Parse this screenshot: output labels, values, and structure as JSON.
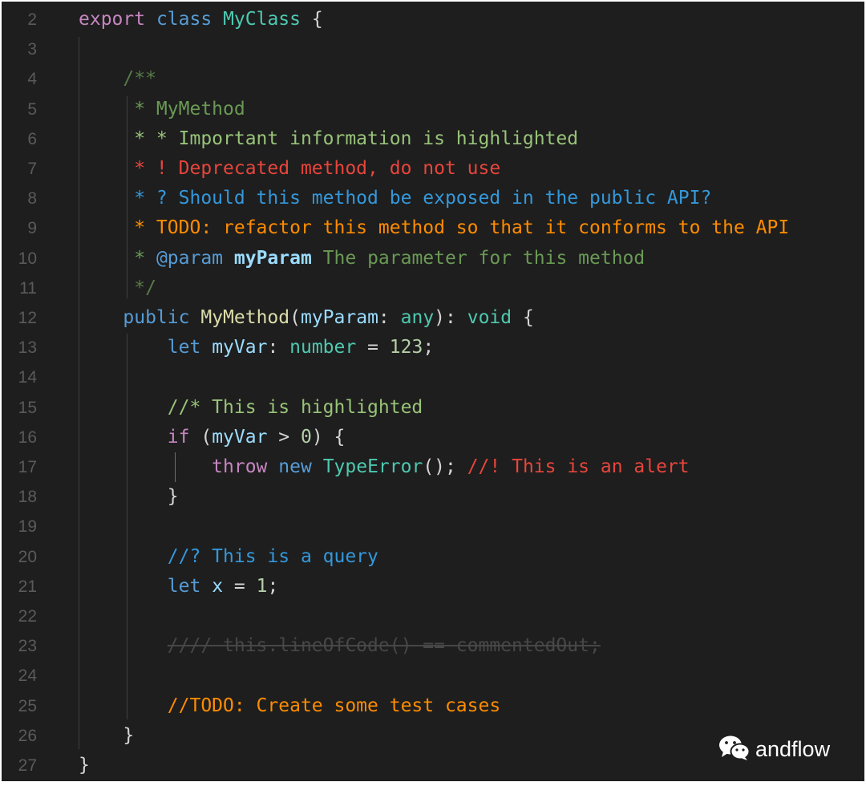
{
  "editor": {
    "lines": [
      {
        "num": "2",
        "tokens": [
          {
            "t": "export",
            "c": "kw2"
          },
          {
            "t": " ",
            "c": "punc"
          },
          {
            "t": "class",
            "c": "kw"
          },
          {
            "t": " ",
            "c": "punc"
          },
          {
            "t": "MyClass",
            "c": "cls"
          },
          {
            "t": " {",
            "c": "punc"
          }
        ]
      },
      {
        "num": "3",
        "tokens": []
      },
      {
        "num": "4",
        "tokens": [
          {
            "t": "    /**",
            "c": "cmt-dim"
          }
        ]
      },
      {
        "num": "5",
        "tokens": [
          {
            "t": "     * MyMethod",
            "c": "cmt"
          }
        ]
      },
      {
        "num": "6",
        "tokens": [
          {
            "t": "     * * Important information is highlighted",
            "c": "hl-green"
          }
        ]
      },
      {
        "num": "7",
        "tokens": [
          {
            "t": "     * ! Deprecated method, do not use",
            "c": "hl-red"
          }
        ]
      },
      {
        "num": "8",
        "tokens": [
          {
            "t": "     * ? Should this method be exposed in the public API?",
            "c": "hl-blue"
          }
        ]
      },
      {
        "num": "9",
        "tokens": [
          {
            "t": "     * TODO: refactor this method so that it conforms to the API",
            "c": "hl-orange"
          }
        ]
      },
      {
        "num": "10",
        "tokens": [
          {
            "t": "     * ",
            "c": "cmt"
          },
          {
            "t": "@param",
            "c": "kw"
          },
          {
            "t": " ",
            "c": "cmt"
          },
          {
            "t": "myParam",
            "c": "var bold"
          },
          {
            "t": " The parameter for this method",
            "c": "cmt"
          }
        ]
      },
      {
        "num": "11",
        "tokens": [
          {
            "t": "     */",
            "c": "cmt-dim"
          }
        ]
      },
      {
        "num": "12",
        "tokens": [
          {
            "t": "    ",
            "c": "punc"
          },
          {
            "t": "public",
            "c": "kw"
          },
          {
            "t": " ",
            "c": "punc"
          },
          {
            "t": "MyMethod",
            "c": "fn"
          },
          {
            "t": "(",
            "c": "punc"
          },
          {
            "t": "myParam",
            "c": "var"
          },
          {
            "t": ": ",
            "c": "punc"
          },
          {
            "t": "any",
            "c": "cls"
          },
          {
            "t": "): ",
            "c": "punc"
          },
          {
            "t": "void",
            "c": "cls"
          },
          {
            "t": " {",
            "c": "punc"
          }
        ]
      },
      {
        "num": "13",
        "tokens": [
          {
            "t": "        ",
            "c": "punc"
          },
          {
            "t": "let",
            "c": "kw"
          },
          {
            "t": " ",
            "c": "punc"
          },
          {
            "t": "myVar",
            "c": "var"
          },
          {
            "t": ": ",
            "c": "punc"
          },
          {
            "t": "number",
            "c": "cls"
          },
          {
            "t": " = ",
            "c": "punc"
          },
          {
            "t": "123",
            "c": "num"
          },
          {
            "t": ";",
            "c": "punc"
          }
        ]
      },
      {
        "num": "14",
        "tokens": []
      },
      {
        "num": "15",
        "tokens": [
          {
            "t": "        //* This is highlighted",
            "c": "hl-green"
          }
        ]
      },
      {
        "num": "16",
        "tokens": [
          {
            "t": "        ",
            "c": "punc"
          },
          {
            "t": "if",
            "c": "kw2"
          },
          {
            "t": " (",
            "c": "punc"
          },
          {
            "t": "myVar",
            "c": "var"
          },
          {
            "t": " > ",
            "c": "punc"
          },
          {
            "t": "0",
            "c": "num"
          },
          {
            "t": ") {",
            "c": "punc"
          }
        ]
      },
      {
        "num": "17",
        "tokens": [
          {
            "t": "            ",
            "c": "punc"
          },
          {
            "t": "throw",
            "c": "kw2"
          },
          {
            "t": " ",
            "c": "punc"
          },
          {
            "t": "new",
            "c": "kw"
          },
          {
            "t": " ",
            "c": "punc"
          },
          {
            "t": "TypeError",
            "c": "cls"
          },
          {
            "t": "(); ",
            "c": "punc"
          },
          {
            "t": "//! This is an alert",
            "c": "hl-red"
          }
        ]
      },
      {
        "num": "18",
        "tokens": [
          {
            "t": "        }",
            "c": "punc"
          }
        ]
      },
      {
        "num": "19",
        "tokens": []
      },
      {
        "num": "20",
        "tokens": [
          {
            "t": "        //? This is a query",
            "c": "hl-blue"
          }
        ]
      },
      {
        "num": "21",
        "tokens": [
          {
            "t": "        ",
            "c": "punc"
          },
          {
            "t": "let",
            "c": "kw"
          },
          {
            "t": " ",
            "c": "punc"
          },
          {
            "t": "x",
            "c": "var"
          },
          {
            "t": " = ",
            "c": "punc"
          },
          {
            "t": "1",
            "c": "num"
          },
          {
            "t": ";",
            "c": "punc"
          }
        ]
      },
      {
        "num": "22",
        "tokens": []
      },
      {
        "num": "23",
        "tokens": [
          {
            "t": "        ",
            "c": "punc"
          },
          {
            "t": "//// this.lineOfCode() == commentedOut;",
            "c": "strike"
          }
        ]
      },
      {
        "num": "24",
        "tokens": []
      },
      {
        "num": "25",
        "tokens": [
          {
            "t": "        //TODO: Create some test cases",
            "c": "hl-orange"
          }
        ]
      },
      {
        "num": "26",
        "tokens": [
          {
            "t": "    }",
            "c": "punc"
          }
        ]
      },
      {
        "num": "27",
        "tokens": [
          {
            "t": "}",
            "c": "punc"
          }
        ]
      }
    ]
  },
  "watermark": {
    "icon": "wechat-icon",
    "text": "andflow"
  },
  "colors": {
    "background": "#1e1e1e",
    "keyword": "#569cd6",
    "control": "#c586c0",
    "type": "#4ec9b0",
    "function": "#dcdcaa",
    "variable": "#9cdcfe",
    "number": "#b5cea8",
    "comment": "#6a9955",
    "highlight_green": "#98c379",
    "highlight_red": "#e8453c",
    "highlight_blue": "#3498db",
    "highlight_orange": "#ff8c00"
  }
}
